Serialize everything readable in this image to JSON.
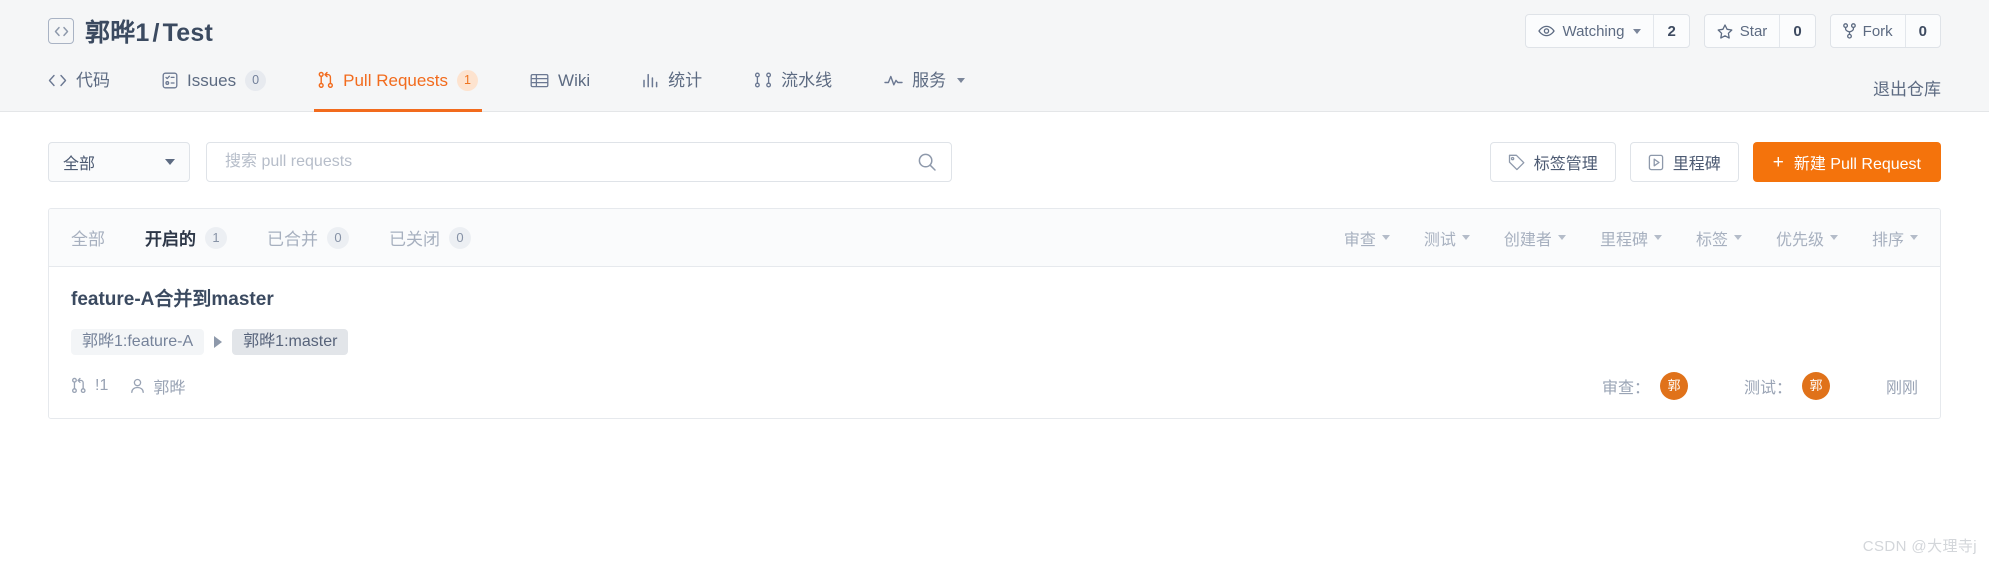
{
  "header": {
    "repo_icon": "code-brackets-icon",
    "owner": "郭晔1",
    "separator": "/",
    "repo": "Test",
    "actions": [
      {
        "icon": "eye-icon",
        "label": "Watching",
        "count": "2",
        "has_caret": true
      },
      {
        "icon": "star-icon",
        "label": "Star",
        "count": "0",
        "has_caret": false
      },
      {
        "icon": "fork-icon",
        "label": "Fork",
        "count": "0",
        "has_caret": false
      }
    ]
  },
  "nav": {
    "items": [
      {
        "icon": "code-icon",
        "label": "代码",
        "badge": null,
        "active": false,
        "caret": false
      },
      {
        "icon": "issues-icon",
        "label": "Issues",
        "badge": "0",
        "active": false,
        "caret": false
      },
      {
        "icon": "pull-request-icon",
        "label": "Pull Requests",
        "badge": "1",
        "active": true,
        "caret": false
      },
      {
        "icon": "wiki-icon",
        "label": "Wiki",
        "badge": null,
        "active": false,
        "caret": false
      },
      {
        "icon": "stats-icon",
        "label": "统计",
        "badge": null,
        "active": false,
        "caret": false
      },
      {
        "icon": "pipeline-icon",
        "label": "流水线",
        "badge": null,
        "active": false,
        "caret": false
      },
      {
        "icon": "service-icon",
        "label": "服务",
        "badge": null,
        "active": false,
        "caret": true
      }
    ],
    "exit_label": "退出仓库"
  },
  "toolbar": {
    "scope_select": "全部",
    "search_placeholder": "搜索 pull requests",
    "search_value": "",
    "search_icon": "search-icon",
    "label_manage": "标签管理",
    "label_manage_icon": "tag-icon",
    "milestone": "里程碑",
    "milestone_icon": "milestone-icon",
    "new_pr": "新建 Pull Request",
    "new_pr_plus": "+"
  },
  "list": {
    "state_tabs": [
      {
        "label": "全部",
        "count": null,
        "current": false
      },
      {
        "label": "开启的",
        "count": "1",
        "current": true
      },
      {
        "label": "已合并",
        "count": "0",
        "current": false
      },
      {
        "label": "已关闭",
        "count": "0",
        "current": false
      }
    ],
    "filters": [
      {
        "label": "审查"
      },
      {
        "label": "测试"
      },
      {
        "label": "创建者"
      },
      {
        "label": "里程碑"
      },
      {
        "label": "标签"
      },
      {
        "label": "优先级"
      },
      {
        "label": "排序"
      }
    ],
    "rows": [
      {
        "title": "feature-A合并到master",
        "source_branch": "郭晔1:feature-A",
        "target_branch": "郭晔1:master",
        "merge_icon": "pull-request-icon",
        "pr_number": "!1",
        "author_icon": "user-icon",
        "author": "郭晔",
        "review_label": "审查：",
        "review_avatar": "郭",
        "test_label": "测试：",
        "test_avatar": "郭",
        "time": "刚刚"
      }
    ]
  },
  "watermark": "CSDN @大理寺j",
  "colors": {
    "accent": "#f4730c",
    "accent_tab": "#f26b1d",
    "avatar": "#e0721a",
    "header_bg": "#f5f6f7",
    "text": "#3b4a60",
    "muted": "#99a3b4"
  }
}
